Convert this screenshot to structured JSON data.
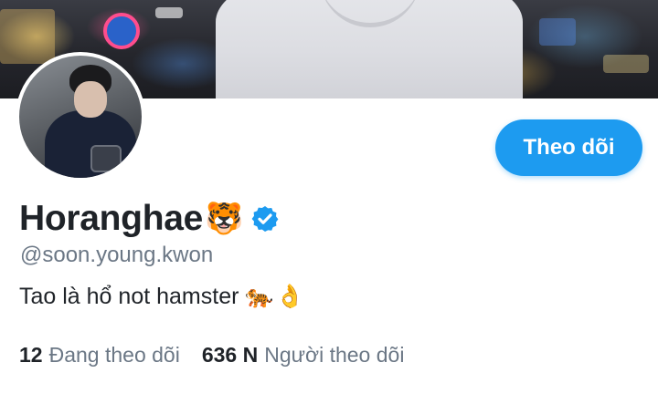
{
  "profile": {
    "display_name": "Horanghae",
    "name_emoji": "🐯",
    "verified_icon": "verified-badge-icon",
    "handle": "@soon.young.kwon",
    "bio_text": "Tao là hổ not hamster",
    "bio_emoji_1": "🐅",
    "bio_emoji_2": "👌"
  },
  "actions": {
    "follow_label": "Theo dõi"
  },
  "stats": {
    "following_count": "12",
    "following_label": "Đang theo dõi",
    "followers_count": "636 N",
    "followers_label": "Người theo dõi"
  },
  "colors": {
    "accent": "#1d9bf0",
    "text_primary": "#1f2328",
    "text_secondary": "#6b7785"
  }
}
